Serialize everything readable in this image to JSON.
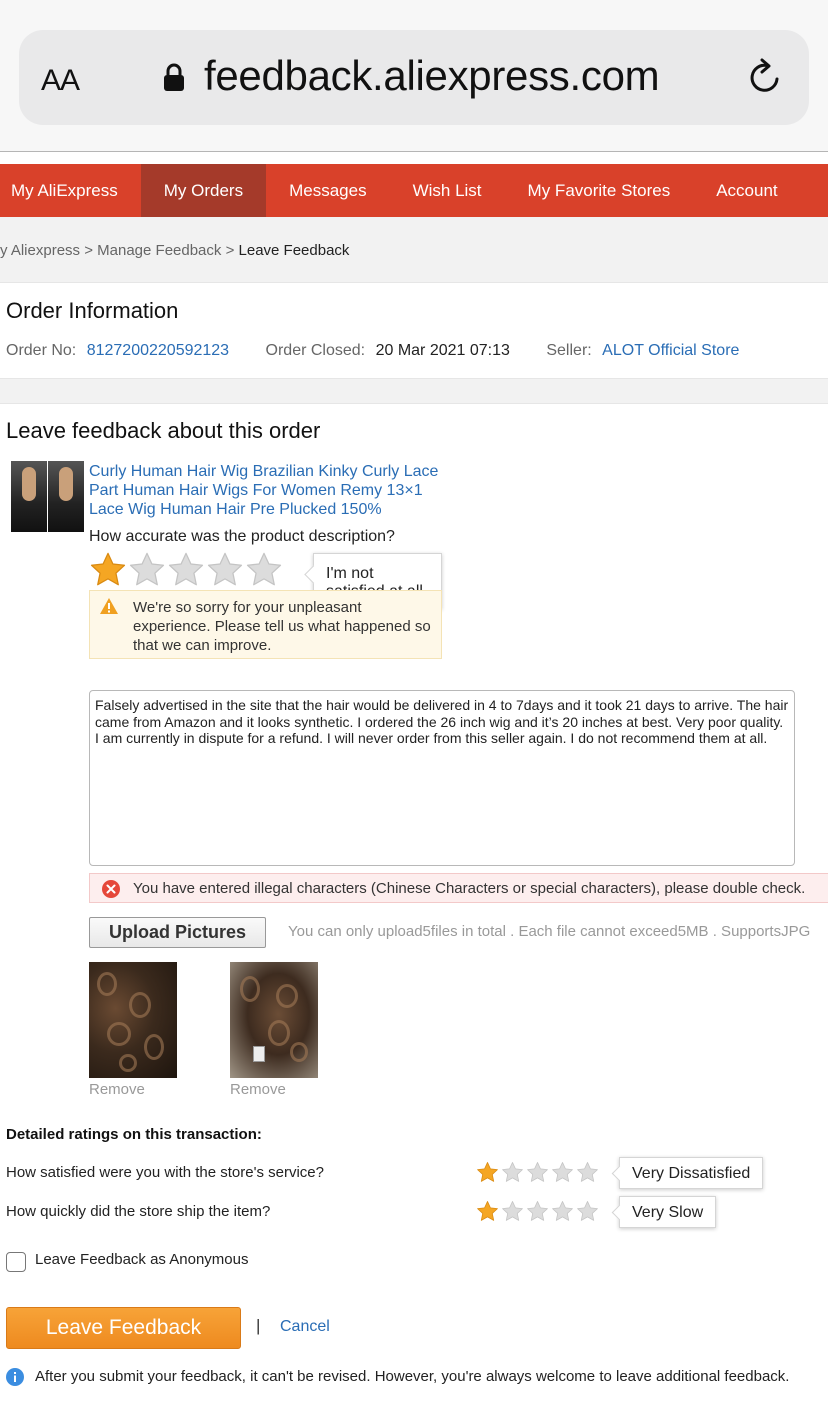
{
  "browser": {
    "aa_label": "AA",
    "url": "feedback.aliexpress.com"
  },
  "nav": {
    "items": [
      {
        "label": "My AliExpress"
      },
      {
        "label": "My Orders"
      },
      {
        "label": "Messages"
      },
      {
        "label": "Wish List"
      },
      {
        "label": "My Favorite Stores"
      },
      {
        "label": "Account"
      }
    ],
    "active": "My Orders"
  },
  "breadcrumb": {
    "items": [
      "y Aliexpress",
      "Manage Feedback",
      "Leave Feedback"
    ],
    "separator": " > "
  },
  "order": {
    "title": "Order Information",
    "order_no_label": "Order No:",
    "order_no": "8127200220592123",
    "closed_label": "Order Closed:",
    "closed_value": "20 Mar 2021 07:13",
    "seller_label": "Seller:",
    "seller": "ALOT Official Store"
  },
  "feedback": {
    "title": "Leave feedback about this order",
    "product_title": "Curly Human Hair Wig Brazilian Kinky Curly Lace Part Human Hair Wigs For Women Remy 13×1 Lace Wig Human Hair Pre Plucked 150%",
    "question": "How accurate was the product description?",
    "rating": 1,
    "rating_max": 5,
    "rating_tooltip": "I'm not satisfied at all",
    "warning_text": "We're so sorry for your unpleasant experience. Please tell us what happened so that we can improve.",
    "comment": "Falsely advertised in the site that the hair would be delivered in 4 to 7days and it took 21 days to arrive. The hair came from Amazon and it looks synthetic. I ordered the 26 inch wig and it’s 20 inches at best. Very poor quality. I am currently in dispute for a refund. I will never order from this seller again. I do not recommend them at all.",
    "error_text": "You have entered illegal characters (Chinese Characters or special characters), please double check.",
    "upload_label": "Upload Pictures",
    "upload_hint": "You can only upload5files in total . Each file cannot exceed5MB . SupportsJPG",
    "pictures": [
      {
        "remove_label": "Remove"
      },
      {
        "remove_label": "Remove"
      }
    ]
  },
  "detailed": {
    "title": "Detailed ratings on this transaction:",
    "items": [
      {
        "question": "How satisfied were you with the store's service?",
        "rating": 1,
        "rating_max": 5,
        "tooltip": "Very Dissatisfied"
      },
      {
        "question": "How quickly did the store ship the item?",
        "rating": 1,
        "rating_max": 5,
        "tooltip": "Very Slow"
      }
    ]
  },
  "anonymous": {
    "label": "Leave Feedback as Anonymous",
    "checked": false
  },
  "actions": {
    "submit_label": "Leave Feedback",
    "separator": "|",
    "cancel_label": "Cancel"
  },
  "notice": "After you submit your feedback, it can't be revised. However, you're always welcome to leave additional feedback.",
  "colors": {
    "nav_bg": "#d9412a",
    "nav_active_bg": "#a53a2a",
    "link": "#2a6db5",
    "star_active": "#f5a623",
    "star_inactive": "#dcdcdc",
    "submit_bg": "#f39a2c"
  }
}
